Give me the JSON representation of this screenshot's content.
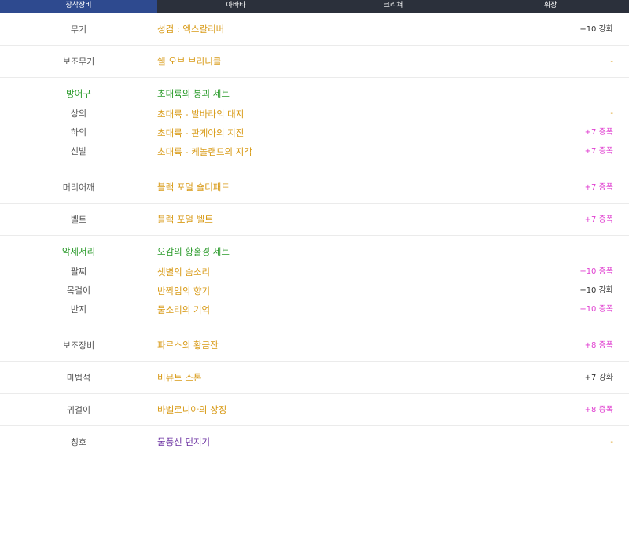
{
  "tabs": [
    {
      "label": "장착장비",
      "active": true
    },
    {
      "label": "아바타"
    },
    {
      "label": "크리쳐"
    },
    {
      "label": "휘장"
    }
  ],
  "rows": [
    {
      "label": "무기",
      "name": "성검 : 엑스칼리버",
      "enh": "+10 강화",
      "enh_type": "white"
    },
    {
      "label": "보조무기",
      "name": "쉘 오브 브리니클",
      "enh": "-",
      "enh_type": "none"
    },
    {
      "set": true,
      "title": "방어구",
      "set_name": "초대륙의 붕괴 세트",
      "items": [
        {
          "label": "상의",
          "name": "초대륙 - 발바라의 대지",
          "enh": "-",
          "enh_type": "none"
        },
        {
          "label": "하의",
          "name": "초대륙 - 판게아의 지진",
          "enh": "+7 증폭",
          "enh_type": "pink"
        },
        {
          "label": "신발",
          "name": "초대륙 - 케놀랜드의 지각",
          "enh": "+7 증폭",
          "enh_type": "pink"
        }
      ]
    },
    {
      "label": "머리어깨",
      "name": "블랙 포멀 숄더패드",
      "enh": "+7 증폭",
      "enh_type": "pink"
    },
    {
      "label": "벨트",
      "name": "블랙 포멀 벨트",
      "enh": "+7 증폭",
      "enh_type": "pink"
    },
    {
      "set": true,
      "title": "악세서리",
      "set_name": "오감의 황홀경 세트",
      "items": [
        {
          "label": "팔찌",
          "name": "샛별의 숨소리",
          "enh": "+10 증폭",
          "enh_type": "pink"
        },
        {
          "label": "목걸이",
          "name": "반짝임의 향기",
          "enh": "+10 강화",
          "enh_type": "white"
        },
        {
          "label": "반지",
          "name": "물소리의 기억",
          "enh": "+10 증폭",
          "enh_type": "pink"
        }
      ]
    },
    {
      "label": "보조장비",
      "name": "파르스의 황금잔",
      "enh": "+8 증폭",
      "enh_type": "pink"
    },
    {
      "label": "마법석",
      "name": "비뮤트 스톤",
      "enh": "+7 강화",
      "enh_type": "white"
    },
    {
      "label": "귀걸이",
      "name": "바벨로니아의 상징",
      "enh": "+8 증폭",
      "enh_type": "pink"
    },
    {
      "label": "칭호",
      "name": "물풍선 던지기",
      "enh": "-",
      "enh_type": "none",
      "name_color": "purple"
    }
  ]
}
